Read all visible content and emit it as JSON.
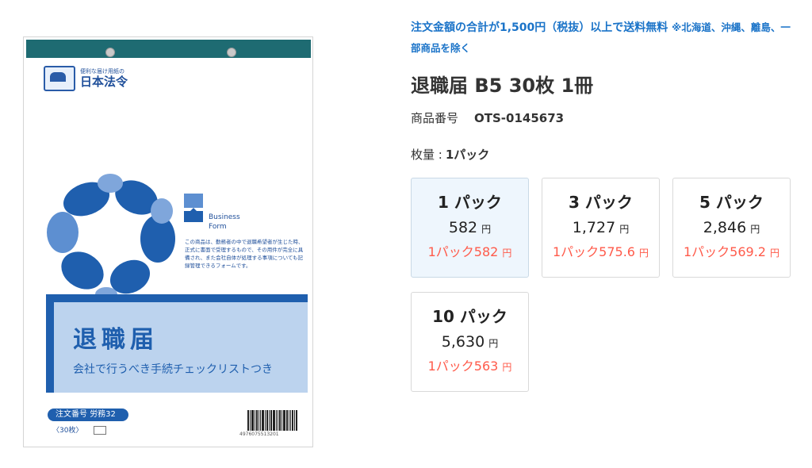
{
  "product_image": {
    "brand_sub": "便利な届け用紙の",
    "brand_main": "日本法令",
    "bf_text_1": "Business",
    "bf_text_2": "Form",
    "description": "この商品は、勤務者の中で退職希望者が生じた時、正式に書面で受理するもので、その用件が完全に具備され、また会社自体が処理する事項についても記録管理できるフォームです。",
    "title": "退職届",
    "subtitle": "会社で行うべき手続チェックリストつき",
    "order_label": "注文番号",
    "order_code": "労務32",
    "qty_note": "〈30枚〉",
    "barcode_number": "4976075513201"
  },
  "notice": {
    "main": "注文金額の合計が1,500円（税抜）以上で送料無料",
    "note": "※北海道、沖縄、離島、一部商品を除く"
  },
  "product": {
    "title": "退職届 B5 30枚 1冊",
    "number_label": "商品番号",
    "number_value": "OTS-0145673",
    "qty_label": "枚量 :",
    "qty_value": "1パック"
  },
  "packs": [
    {
      "name": "1 パック",
      "price": "582",
      "yen": "円",
      "unit": "1パック582",
      "unit_yen": "円"
    },
    {
      "name": "3 パック",
      "price": "1,727",
      "yen": "円",
      "unit": "1パック575.6",
      "unit_yen": "円"
    },
    {
      "name": "5 パック",
      "price": "2,846",
      "yen": "円",
      "unit": "1パック569.2",
      "unit_yen": "円"
    },
    {
      "name": "10 パック",
      "price": "5,630",
      "yen": "円",
      "unit": "1パック563",
      "unit_yen": "円"
    }
  ],
  "colors": {
    "accent_blue": "#1a73c8",
    "unit_price_red": "#ff5a4a",
    "selected_bg": "#eef6fd"
  }
}
